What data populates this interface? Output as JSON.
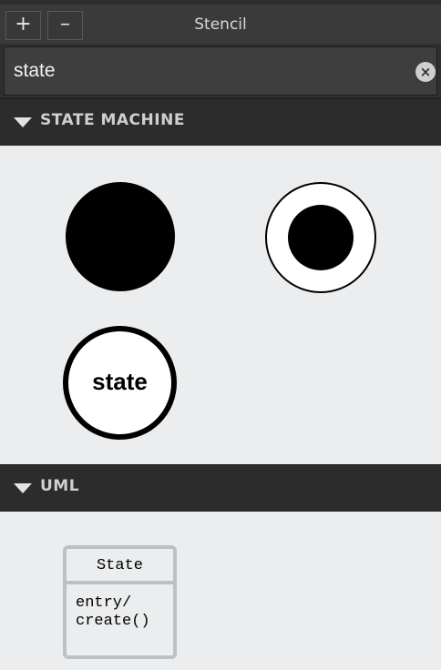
{
  "toolbar": {
    "add_label": "+",
    "remove_label": "–",
    "title": "Stencil"
  },
  "search": {
    "value": "state",
    "clear_icon": "×"
  },
  "sections": [
    {
      "title": "STATE MACHINE",
      "items": [
        {
          "icon": "initial-state-icon"
        },
        {
          "icon": "final-state-icon"
        },
        {
          "label": "state"
        }
      ]
    },
    {
      "title": "UML",
      "items": [
        {
          "name": "State",
          "body_line1": "entry/",
          "body_line2": "create()"
        }
      ]
    }
  ]
}
